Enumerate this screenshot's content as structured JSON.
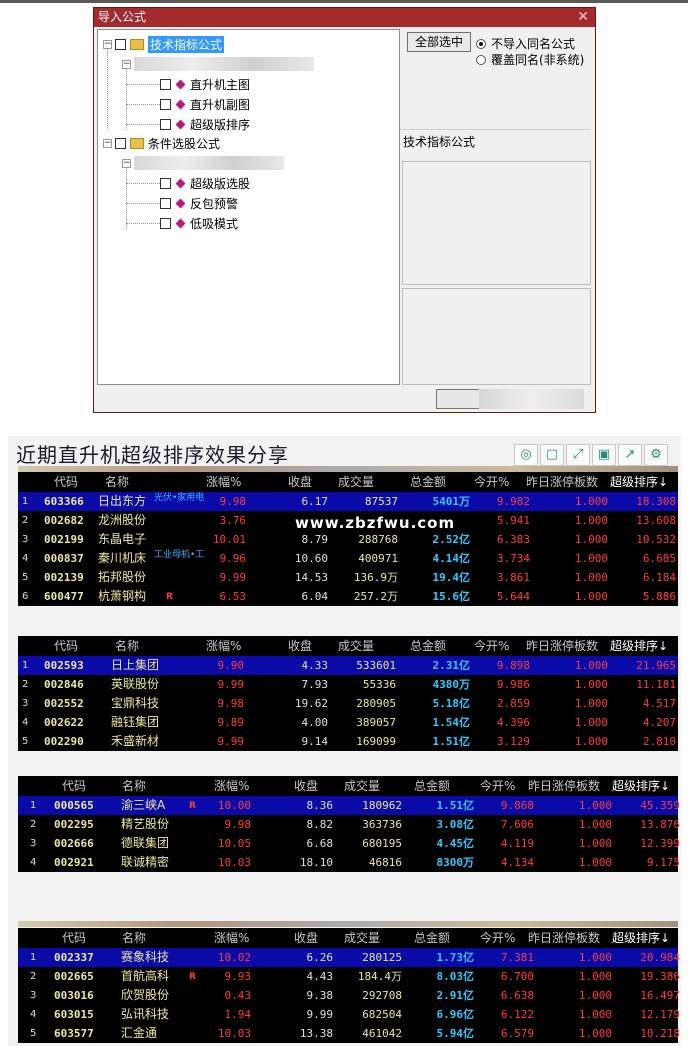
{
  "dialog": {
    "title": "导入公式",
    "close_glyph": "✕",
    "tree": {
      "group1": {
        "label": "技术指标公式",
        "items": [
          "直升机主图",
          "直升机副图",
          "超级版排序"
        ]
      },
      "group2": {
        "label": "条件选股公式",
        "items": [
          "超级版选股",
          "反包预警",
          "低吸模式"
        ]
      }
    },
    "select_all_label": "全部选中",
    "radio_options": [
      {
        "label": "不导入同名公式",
        "checked": true
      },
      {
        "label": "覆盖同名(非系统)",
        "checked": false
      }
    ],
    "right_label": "技术指标公式"
  },
  "results": {
    "title": "近期直升机超级排序效果分享",
    "toolbar_icons": [
      "search-icon",
      "copy-icon",
      "expand-icon",
      "save-icon",
      "share-icon",
      "settings-icon"
    ],
    "toolbar_glyphs": [
      "◎",
      "▢",
      "⤢",
      "▣",
      "↗",
      "⚙"
    ],
    "watermark": "www.zbzfwu.com",
    "columns": [
      "代码",
      "名称",
      "涨幅%",
      "收盘",
      "成交量",
      "总金额",
      "今开%",
      "昨日涨停板数",
      "超级排序↓"
    ],
    "tables": [
      {
        "rows": [
          {
            "idx": "1",
            "code": "603366",
            "name": "日出东方",
            "tag": "光伏•家用电",
            "chg": "9.98",
            "close": "6.17",
            "vol": "87537",
            "amt": "5401万",
            "open": "9.982",
            "prev": "1.000",
            "rank": "18.308",
            "r": false
          },
          {
            "idx": "2",
            "code": "002682",
            "name": "龙洲股份",
            "tag": "",
            "chg": "3.76",
            "close": "",
            "vol": "",
            "amt": "",
            "open": "5.941",
            "prev": "1.000",
            "rank": "13.608",
            "r": false
          },
          {
            "idx": "3",
            "code": "002199",
            "name": "东晶电子",
            "tag": "",
            "chg": "10.01",
            "close": "8.79",
            "vol": "288768",
            "amt": "2.52亿",
            "open": "6.383",
            "prev": "1.000",
            "rank": "10.532",
            "r": false
          },
          {
            "idx": "4",
            "code": "000837",
            "name": "秦川机床",
            "tag": "工业母机•工",
            "chg": "9.96",
            "close": "10.60",
            "vol": "400971",
            "amt": "4.14亿",
            "open": "3.734",
            "prev": "1.000",
            "rank": "6.685",
            "r": false
          },
          {
            "idx": "5",
            "code": "002139",
            "name": "拓邦股份",
            "tag": "",
            "chg": "9.99",
            "close": "14.53",
            "vol": "136.9万",
            "amt": "19.4亿",
            "open": "3.861",
            "prev": "1.000",
            "rank": "6.184",
            "r": false
          },
          {
            "idx": "6",
            "code": "600477",
            "name": "杭萧钢构",
            "tag": "",
            "chg": "6.53",
            "close": "6.04",
            "vol": "257.2万",
            "amt": "15.6亿",
            "open": "5.644",
            "prev": "1.000",
            "rank": "5.886",
            "r": true
          }
        ]
      },
      {
        "rows": [
          {
            "idx": "1",
            "code": "002593",
            "name": "日上集团",
            "tag": "",
            "chg": "9.90",
            "close": "4.33",
            "vol": "533601",
            "amt": "2.31亿",
            "open": "9.898",
            "prev": "1.000",
            "rank": "21.965",
            "r": false
          },
          {
            "idx": "2",
            "code": "002846",
            "name": "英联股份",
            "tag": "",
            "chg": "9.99",
            "close": "7.93",
            "vol": "55336",
            "amt": "4380万",
            "open": "9.986",
            "prev": "1.000",
            "rank": "11.181",
            "r": false
          },
          {
            "idx": "3",
            "code": "002552",
            "name": "宝鼎科技",
            "tag": "",
            "chg": "9.98",
            "close": "19.62",
            "vol": "280905",
            "amt": "5.18亿",
            "open": "2.859",
            "prev": "1.000",
            "rank": "4.517",
            "r": false
          },
          {
            "idx": "4",
            "code": "002622",
            "name": "融钰集团",
            "tag": "",
            "chg": "9.89",
            "close": "4.00",
            "vol": "389057",
            "amt": "1.54亿",
            "open": "4.396",
            "prev": "1.000",
            "rank": "4.207",
            "r": false
          },
          {
            "idx": "5",
            "code": "002290",
            "name": "禾盛新材",
            "tag": "",
            "chg": "9.99",
            "close": "9.14",
            "vol": "169099",
            "amt": "1.51亿",
            "open": "3.129",
            "prev": "1.000",
            "rank": "2.810",
            "r": false
          }
        ]
      },
      {
        "rows": [
          {
            "idx": "1",
            "code": "000565",
            "name": "渝三峡A",
            "tag": "",
            "chg": "10.00",
            "close": "8.36",
            "vol": "180962",
            "amt": "1.51亿",
            "open": "9.868",
            "prev": "1.000",
            "rank": "45.359",
            "r": true
          },
          {
            "idx": "2",
            "code": "002295",
            "name": "精艺股份",
            "tag": "",
            "chg": "9.98",
            "close": "8.82",
            "vol": "363736",
            "amt": "3.08亿",
            "open": "7.606",
            "prev": "1.000",
            "rank": "13.876",
            "r": false
          },
          {
            "idx": "3",
            "code": "002666",
            "name": "德联集团",
            "tag": "",
            "chg": "10.05",
            "close": "6.68",
            "vol": "680195",
            "amt": "4.45亿",
            "open": "4.119",
            "prev": "1.000",
            "rank": "12.399",
            "r": false
          },
          {
            "idx": "4",
            "code": "002921",
            "name": "联诚精密",
            "tag": "",
            "chg": "10.03",
            "close": "18.10",
            "vol": "46816",
            "amt": "8300万",
            "open": "4.134",
            "prev": "1.000",
            "rank": "9.175",
            "r": false
          }
        ]
      },
      {
        "rows": [
          {
            "idx": "1",
            "code": "002337",
            "name": "赛象科技",
            "tag": "",
            "chg": "10.02",
            "close": "6.26",
            "vol": "280125",
            "amt": "1.73亿",
            "open": "7.381",
            "prev": "1.000",
            "rank": "20.984",
            "r": false
          },
          {
            "idx": "2",
            "code": "002665",
            "name": "首航高科",
            "tag": "",
            "chg": "9.93",
            "close": "4.43",
            "vol": "184.4万",
            "amt": "8.03亿",
            "open": "6.700",
            "prev": "1.000",
            "rank": "19.386",
            "r": true
          },
          {
            "idx": "3",
            "code": "003016",
            "name": "欣贺股份",
            "tag": "",
            "chg": "0.43",
            "close": "9.38",
            "vol": "292708",
            "amt": "2.91亿",
            "open": "6.638",
            "prev": "1.000",
            "rank": "16.497",
            "r": false
          },
          {
            "idx": "4",
            "code": "603015",
            "name": "弘讯科技",
            "tag": "",
            "chg": "1.94",
            "close": "9.99",
            "vol": "682504",
            "amt": "6.96亿",
            "open": "6.122",
            "prev": "1.000",
            "rank": "12.179",
            "r": false
          },
          {
            "idx": "5",
            "code": "603577",
            "name": "汇金通",
            "tag": "",
            "chg": "10.03",
            "close": "13.38",
            "vol": "461042",
            "amt": "5.94亿",
            "open": "6.579",
            "prev": "1.000",
            "rank": "10.218",
            "r": false
          }
        ]
      }
    ]
  }
}
